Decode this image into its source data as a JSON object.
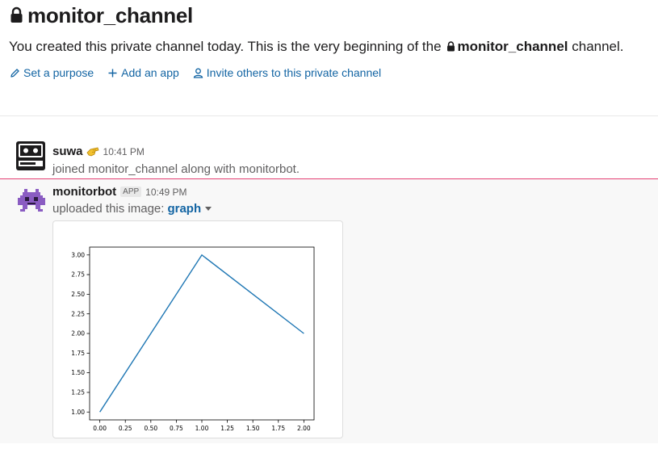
{
  "header": {
    "channel_name": "monitor_channel",
    "intro_prefix": "You created this private channel today. This is the very beginning of the",
    "intro_channel": "monitor_channel",
    "intro_suffix": "channel."
  },
  "actions": {
    "set_purpose": "Set a purpose",
    "add_app": "Add an app",
    "invite": "Invite others to this private channel"
  },
  "messages": [
    {
      "author": "suwa",
      "time": "10:41 PM",
      "text": "joined monitor_channel along with monitorbot."
    },
    {
      "author": "monitorbot",
      "badge": "APP",
      "time": "10:49 PM",
      "text": "uploaded this image:",
      "file_name": "graph"
    }
  ],
  "colors": {
    "link": "#1264a3",
    "new_message_line": "#e01e5a",
    "line_series": "#1f77b4",
    "bot_avatar": "#8a5cc2"
  },
  "chart_data": {
    "type": "line",
    "x": [
      0.0,
      1.0,
      2.0
    ],
    "series": [
      {
        "values": [
          1.0,
          3.0,
          2.0
        ]
      }
    ],
    "xticks": [
      "0.00",
      "0.25",
      "0.50",
      "0.75",
      "1.00",
      "1.25",
      "1.50",
      "1.75",
      "2.00"
    ],
    "yticks": [
      "1.00",
      "1.25",
      "1.50",
      "1.75",
      "2.00",
      "2.25",
      "2.50",
      "2.75",
      "3.00"
    ],
    "xlim": [
      -0.1,
      2.1
    ],
    "ylim": [
      0.9,
      3.1
    ],
    "grid": false,
    "title": "",
    "xlabel": "",
    "ylabel": ""
  }
}
